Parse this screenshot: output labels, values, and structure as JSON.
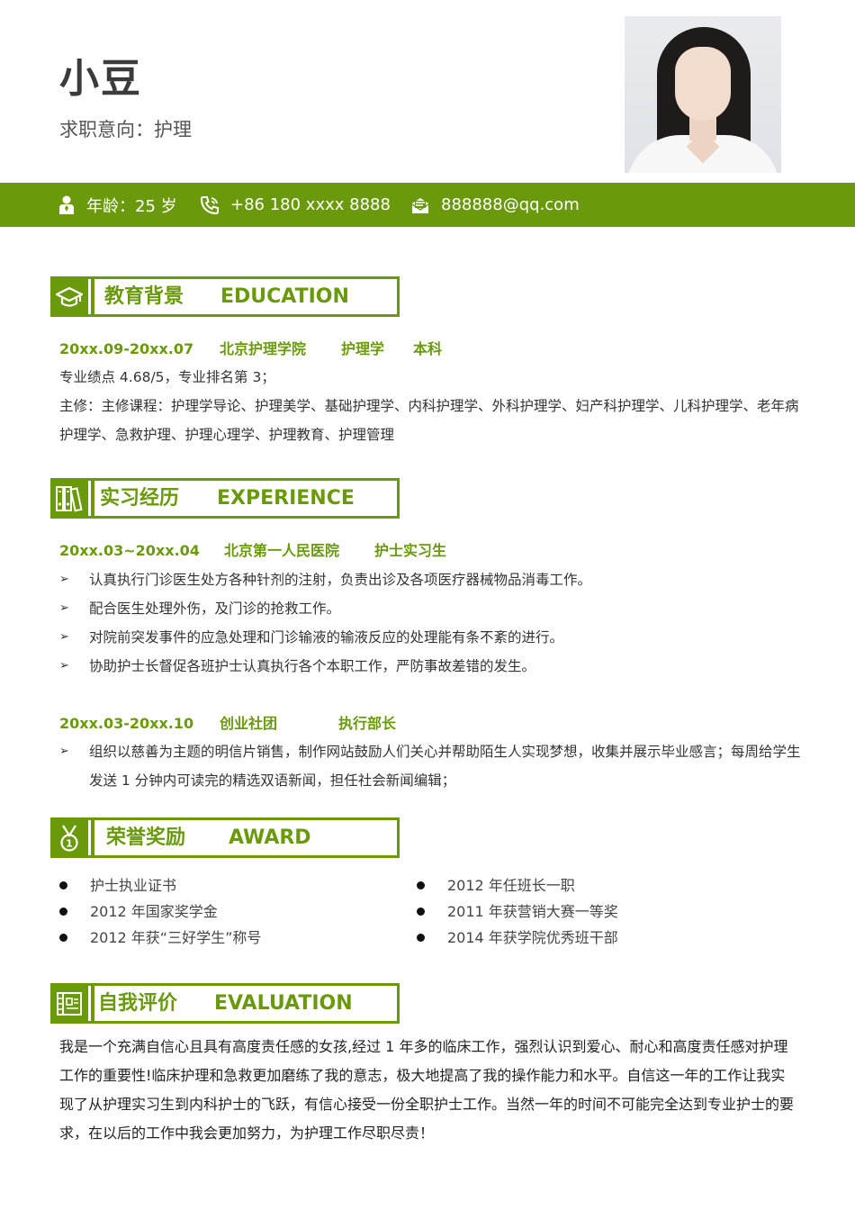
{
  "header": {
    "name": "小豆",
    "intent": "求职意向：护理"
  },
  "info": {
    "age": "年龄：25 岁",
    "phone": "+86 180 xxxx 8888",
    "email": "888888@qq.com",
    "bar_color": "#6a9a0c",
    "icons": [
      "person-icon",
      "phone-icon",
      "mail-icon"
    ]
  },
  "education": {
    "title_cn": "教育背景",
    "title_en": "EDUCATION",
    "icon": "graduation-cap-icon",
    "period": "20xx.09-20xx.07",
    "school": "北京护理学院",
    "major": "护理学",
    "degree": "本科",
    "gpa": "专业绩点 4.68/5，专业排名第 3；",
    "courses": "主修：主修课程：护理学导论、护理美学、基础护理学、内科护理学、外科护理学、妇产科护理学、儿科护理学、老年病护理学、急救护理、护理心理学、护理教育、护理管理"
  },
  "experience": {
    "title_cn": "实习经历",
    "title_en": "EXPERIENCE",
    "icon": "binders-icon",
    "jobs": [
      {
        "period": "20xx.03~20xx.04",
        "org": "北京第一人民医院",
        "role": "护士实习生",
        "items": [
          "认真执行门诊医生处方各种针剂的注射，负责出诊及各项医疗器械物品消毒工作。",
          "配合医生处理外伤，及门诊的抢救工作。",
          "对院前突发事件的应急处理和门诊输液的输液反应的处理能有条不紊的进行。",
          "协助护士长督促各班护士认真执行各个本职工作，严防事故差错的发生。"
        ]
      },
      {
        "period": "20xx.03-20xx.10",
        "org": "创业社团",
        "role": "执行部长",
        "items": [
          "组织以慈善为主题的明信片销售，制作网站鼓励人们关心并帮助陌生人实现梦想，收集并展示毕业感言；每周给学生发送 1 分钟内可读完的精选双语新闻，担任社会新闻编辑；"
        ]
      }
    ]
  },
  "award": {
    "title_cn": "荣誉奖励",
    "title_en": "AWARD",
    "icon": "medal-icon",
    "left": [
      "护士执业证书",
      "2012 年国家奖学金",
      "2012 年获“三好学生”称号"
    ],
    "right": [
      "2012 年任班长一职",
      "2011 年获营销大赛一等奖",
      "2014 年获学院优秀班干部"
    ]
  },
  "evaluation": {
    "title_cn": "自我评价",
    "title_en": "EVALUATION",
    "icon": "profile-card-icon",
    "text": "我是一个充满自信心且具有高度责任感的女孩,经过 1 年多的临床工作，强烈认识到爱心、耐心和高度责任感对护理工作的重要性!临床护理和急救更加磨练了我的意志，极大地提高了我的操作能力和水平。自信这一年的工作让我实现了从护理实习生到内科护士的飞跃，有信心接受一份全职护士工作。当然一年的时间不可能完全达到专业护士的要求，在以后的工作中我会更加努力，为护理工作尽职尽责！"
  }
}
